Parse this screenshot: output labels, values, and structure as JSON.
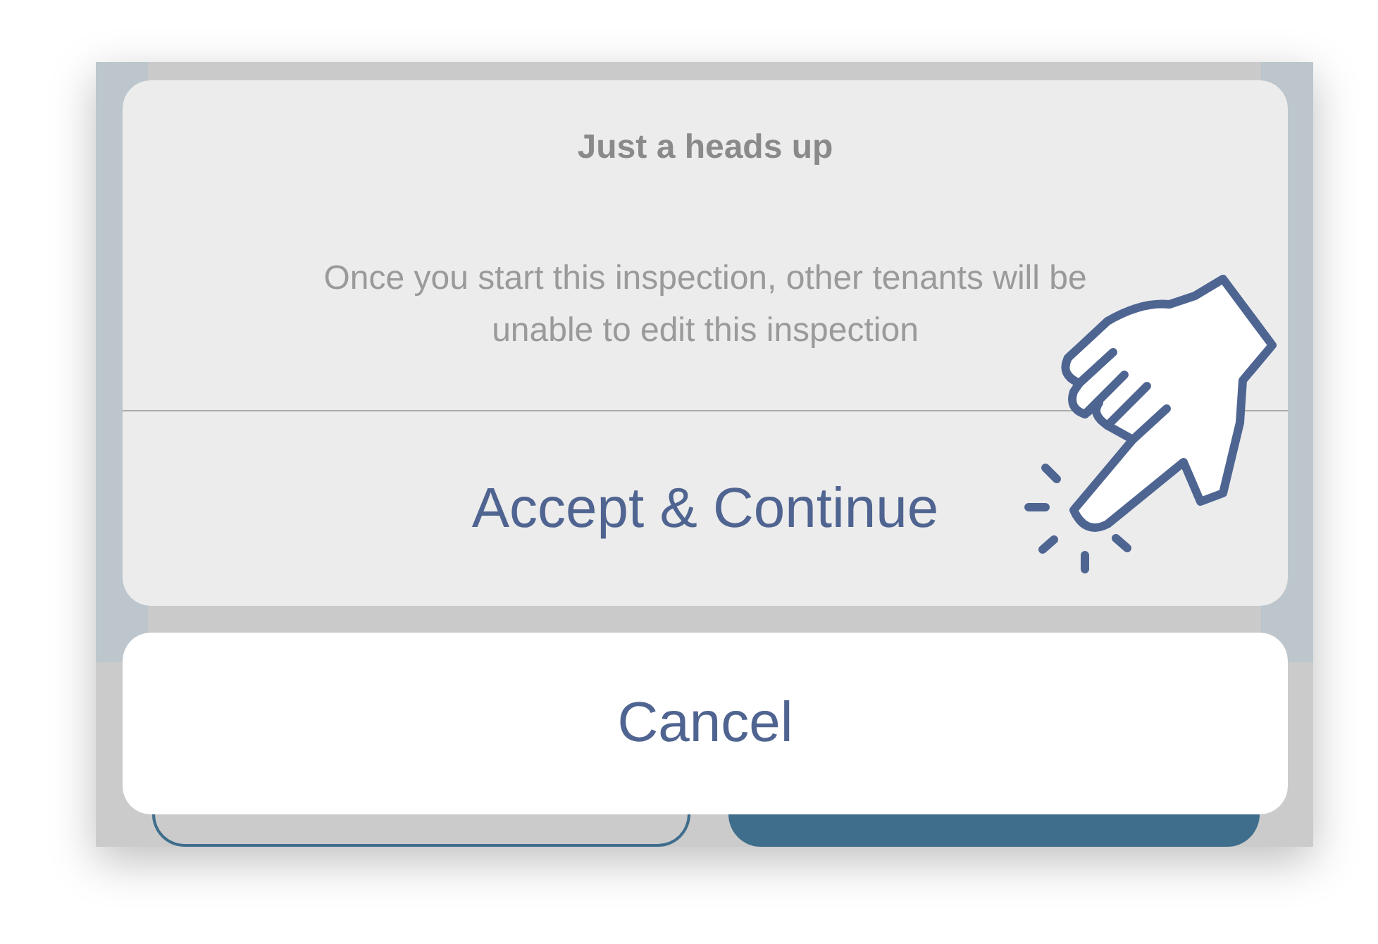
{
  "alert": {
    "title": "Just a heads up",
    "message": "Once you start this inspection, other tenants will be unable to edit this inspection",
    "actions": [
      {
        "label": "Accept & Continue"
      }
    ]
  },
  "cancel": {
    "label": "Cancel"
  }
}
